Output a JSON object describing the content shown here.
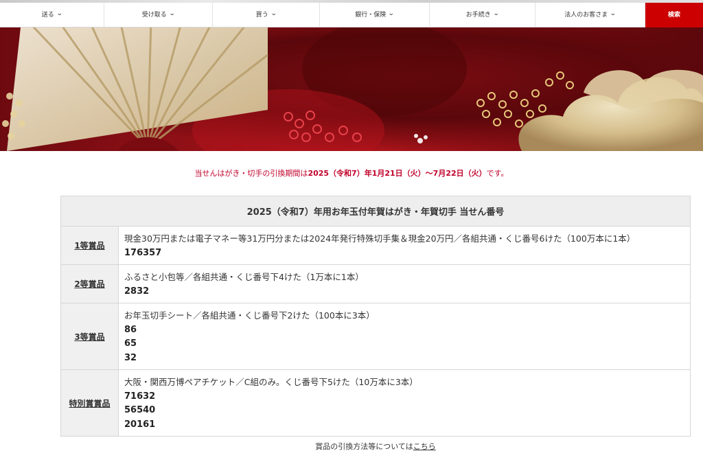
{
  "nav": {
    "items": [
      {
        "label": "送る",
        "width": 152
      },
      {
        "label": "受け取る",
        "width": 158
      },
      {
        "label": "買う",
        "width": 156
      },
      {
        "label": "銀行・保険",
        "width": 160
      },
      {
        "label": "お手続き",
        "width": 154
      },
      {
        "label": "法人のお客さま",
        "width": 160
      }
    ],
    "search_label": "検索"
  },
  "notice": {
    "prefix": "当せんはがき・切手の引換期間は",
    "period": "2025（令和7）年1月21日（火）～7月22日（火）",
    "suffix": "です。"
  },
  "table": {
    "caption": "2025（令和7）年用お年玉付年賀はがき・年賀切手 当せん番号",
    "rows": [
      {
        "rank": "1等賞品",
        "description": "現金30万円または電子マネー等31万円分または2024年発行特殊切手集＆現金20万円／各組共通・くじ番号6けた（100万本に1本）",
        "numbers": [
          "176357"
        ]
      },
      {
        "rank": "2等賞品",
        "description": "ふるさと小包等／各組共通・くじ番号下4けた（1万本に1本）",
        "numbers": [
          "2832"
        ]
      },
      {
        "rank": "3等賞品",
        "description": "お年玉切手シート／各組共通・くじ番号下2けた（100本に3本）",
        "numbers": [
          "86",
          "65",
          "32"
        ]
      },
      {
        "rank": "特別賞賞品",
        "description": "大阪・関西万博ペアチケット／C組のみ。くじ番号下5けた（10万本に3本）",
        "numbers": [
          "71632",
          "56540",
          "20161"
        ]
      }
    ]
  },
  "footer": {
    "text": "賞品の引換方法等については",
    "link": "こちら"
  }
}
